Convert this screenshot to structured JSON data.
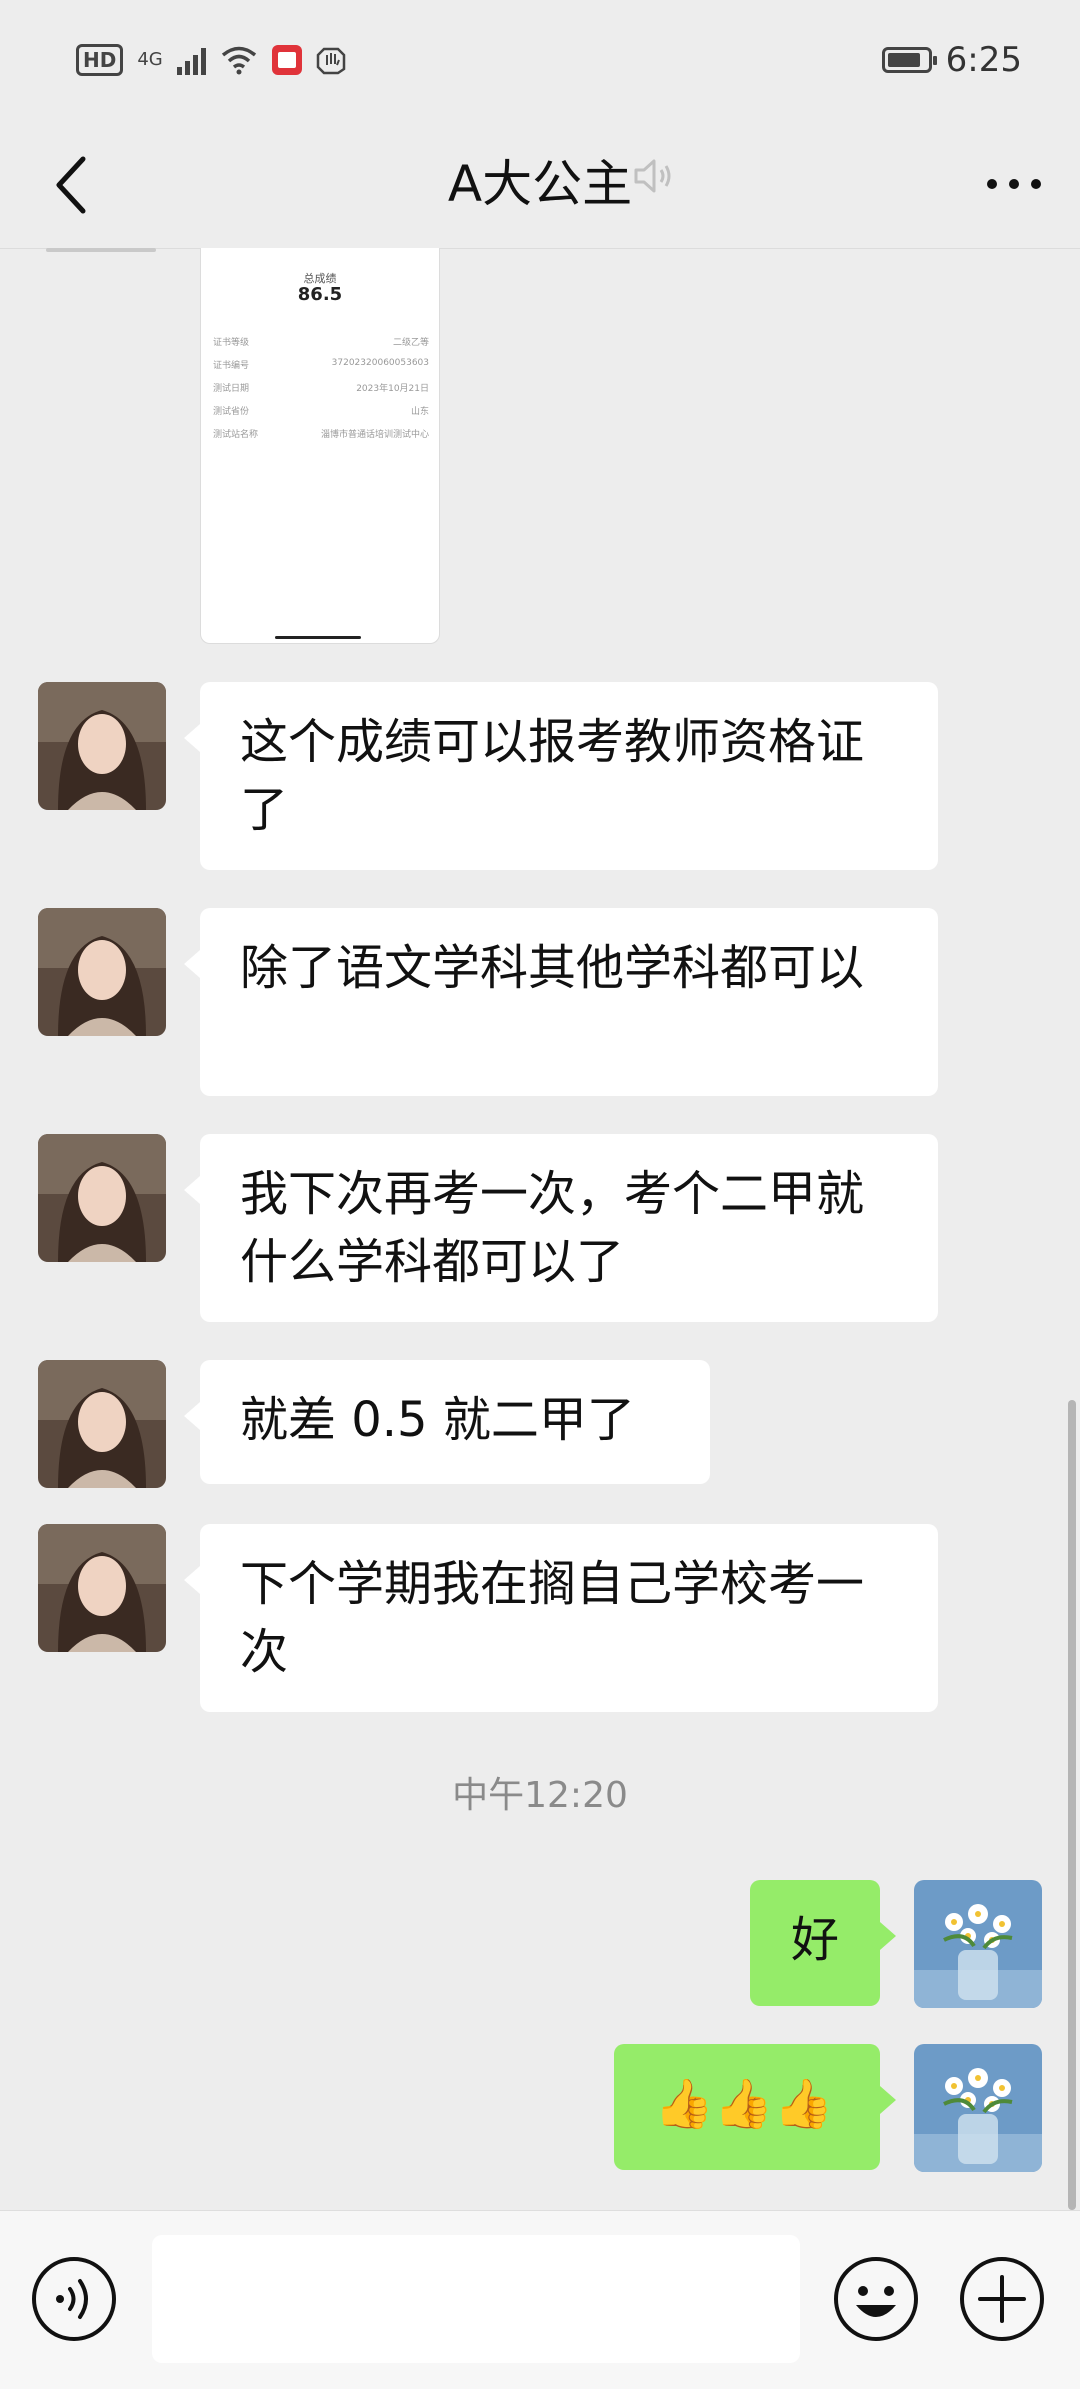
{
  "status_bar": {
    "hd": "HD",
    "network": "4G",
    "time": "6:25"
  },
  "header": {
    "title": "A大公主",
    "back_icon": "chevron-left-icon",
    "mute_icon": "mute-icon",
    "more_icon": "more-icon"
  },
  "score_card": {
    "score_label": "总成绩",
    "score": "86.5",
    "rows": [
      {
        "key": "证书等级",
        "value": "二级乙等"
      },
      {
        "key": "证书编号",
        "value": "37202320060053603"
      },
      {
        "key": "测试日期",
        "value": "2023年10月21日"
      },
      {
        "key": "测试省份",
        "value": "山东"
      },
      {
        "key": "测试站名称",
        "value": "淄博市普通话培训测试中心"
      }
    ]
  },
  "messages": [
    {
      "from": "contact",
      "text": "这个成绩可以报考教师资格证了"
    },
    {
      "from": "contact",
      "text": "除了语文学科其他学科都可以"
    },
    {
      "from": "contact",
      "text": "我下次再考一次，考个二甲就什么学科都可以了"
    },
    {
      "from": "contact",
      "text": "就差 0.5 就二甲了"
    },
    {
      "from": "contact",
      "text": "下个学期我在搁自己学校考一次"
    },
    {
      "from": "me",
      "text": "好"
    },
    {
      "from": "me",
      "text": "👍👍👍"
    }
  ],
  "timestamp": "中午12:20",
  "input_bar": {
    "placeholder": "",
    "voice_icon": "voice-icon",
    "emoji_icon": "emoji-icon",
    "plus_icon": "plus-icon"
  }
}
